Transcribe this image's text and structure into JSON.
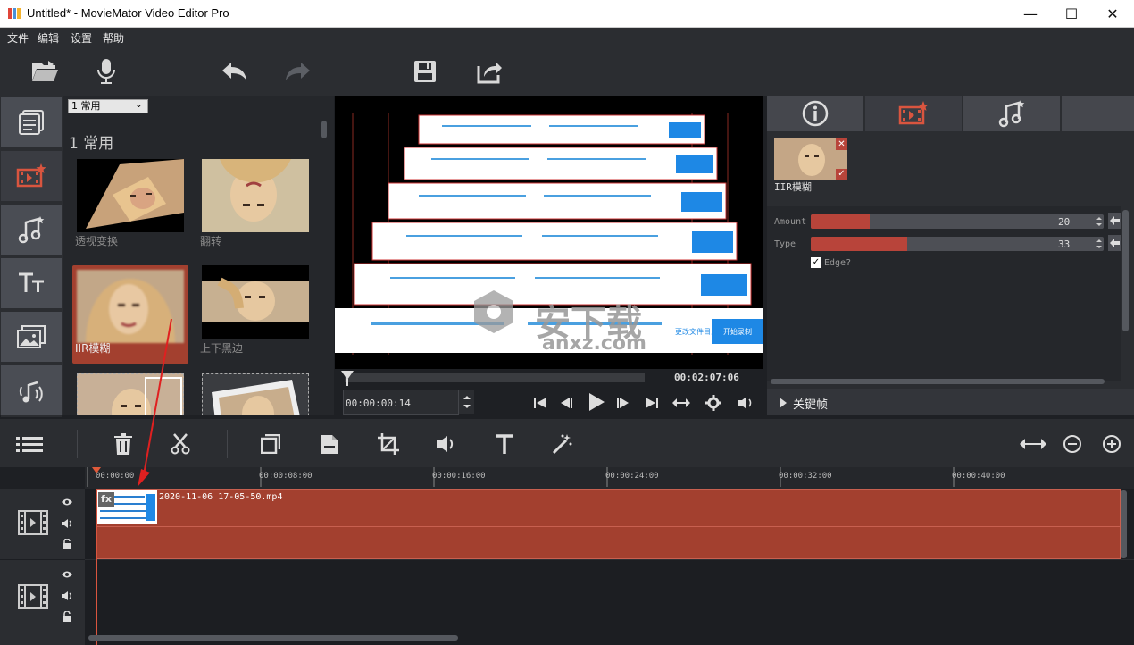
{
  "window": {
    "title": "Untitled* - MovieMator Video Editor Pro",
    "minimize": "—",
    "maximize": "☐",
    "close": "✕"
  },
  "menu": [
    "文件",
    "编辑",
    "设置",
    "帮助"
  ],
  "toolbar": {
    "icons": [
      "open-folder-icon",
      "microphone-icon",
      "undo-icon",
      "redo-icon",
      "save-icon",
      "export-icon"
    ]
  },
  "left_tabs": [
    "playlist-icon",
    "filters-icon",
    "music-icon",
    "text-icon",
    "images-icon",
    "audio-effects-icon"
  ],
  "filters": {
    "select_value": "1 常用",
    "select_arrow": "⌄",
    "category_title": "1 常用",
    "items": [
      "透视变换",
      "翻转",
      "IIR模糊",
      "上下黑边",
      "",
      ""
    ]
  },
  "preview": {
    "total_time": "00:02:07:06",
    "current_time": "00:00:00:14",
    "watermark": "安下载",
    "watermark_sub": "anxz.com",
    "record_button": "开始录制",
    "file_link": "更改文件目录"
  },
  "properties": {
    "filter_name": "IIR模糊",
    "params": [
      {
        "name": "Amount",
        "value": "20",
        "fill": 0.2
      },
      {
        "name": "Type",
        "value": "33",
        "fill": 0.33
      }
    ],
    "edge_label": "Edge?",
    "edge_checked": "✓",
    "keyframes_label": "关键帧"
  },
  "timeline": {
    "ticks": [
      "00:00:00",
      "00:00:08:00",
      "00:00:16:00",
      "00:00:24:00",
      "00:00:32:00",
      "00:00:40:00"
    ],
    "clip_name": "2020-11-06 17-05-50.mp4",
    "fx_badge": "fx"
  },
  "colors": {
    "accent": "#b8443a",
    "panel": "#2b2d31",
    "dark": "#1e2024"
  }
}
